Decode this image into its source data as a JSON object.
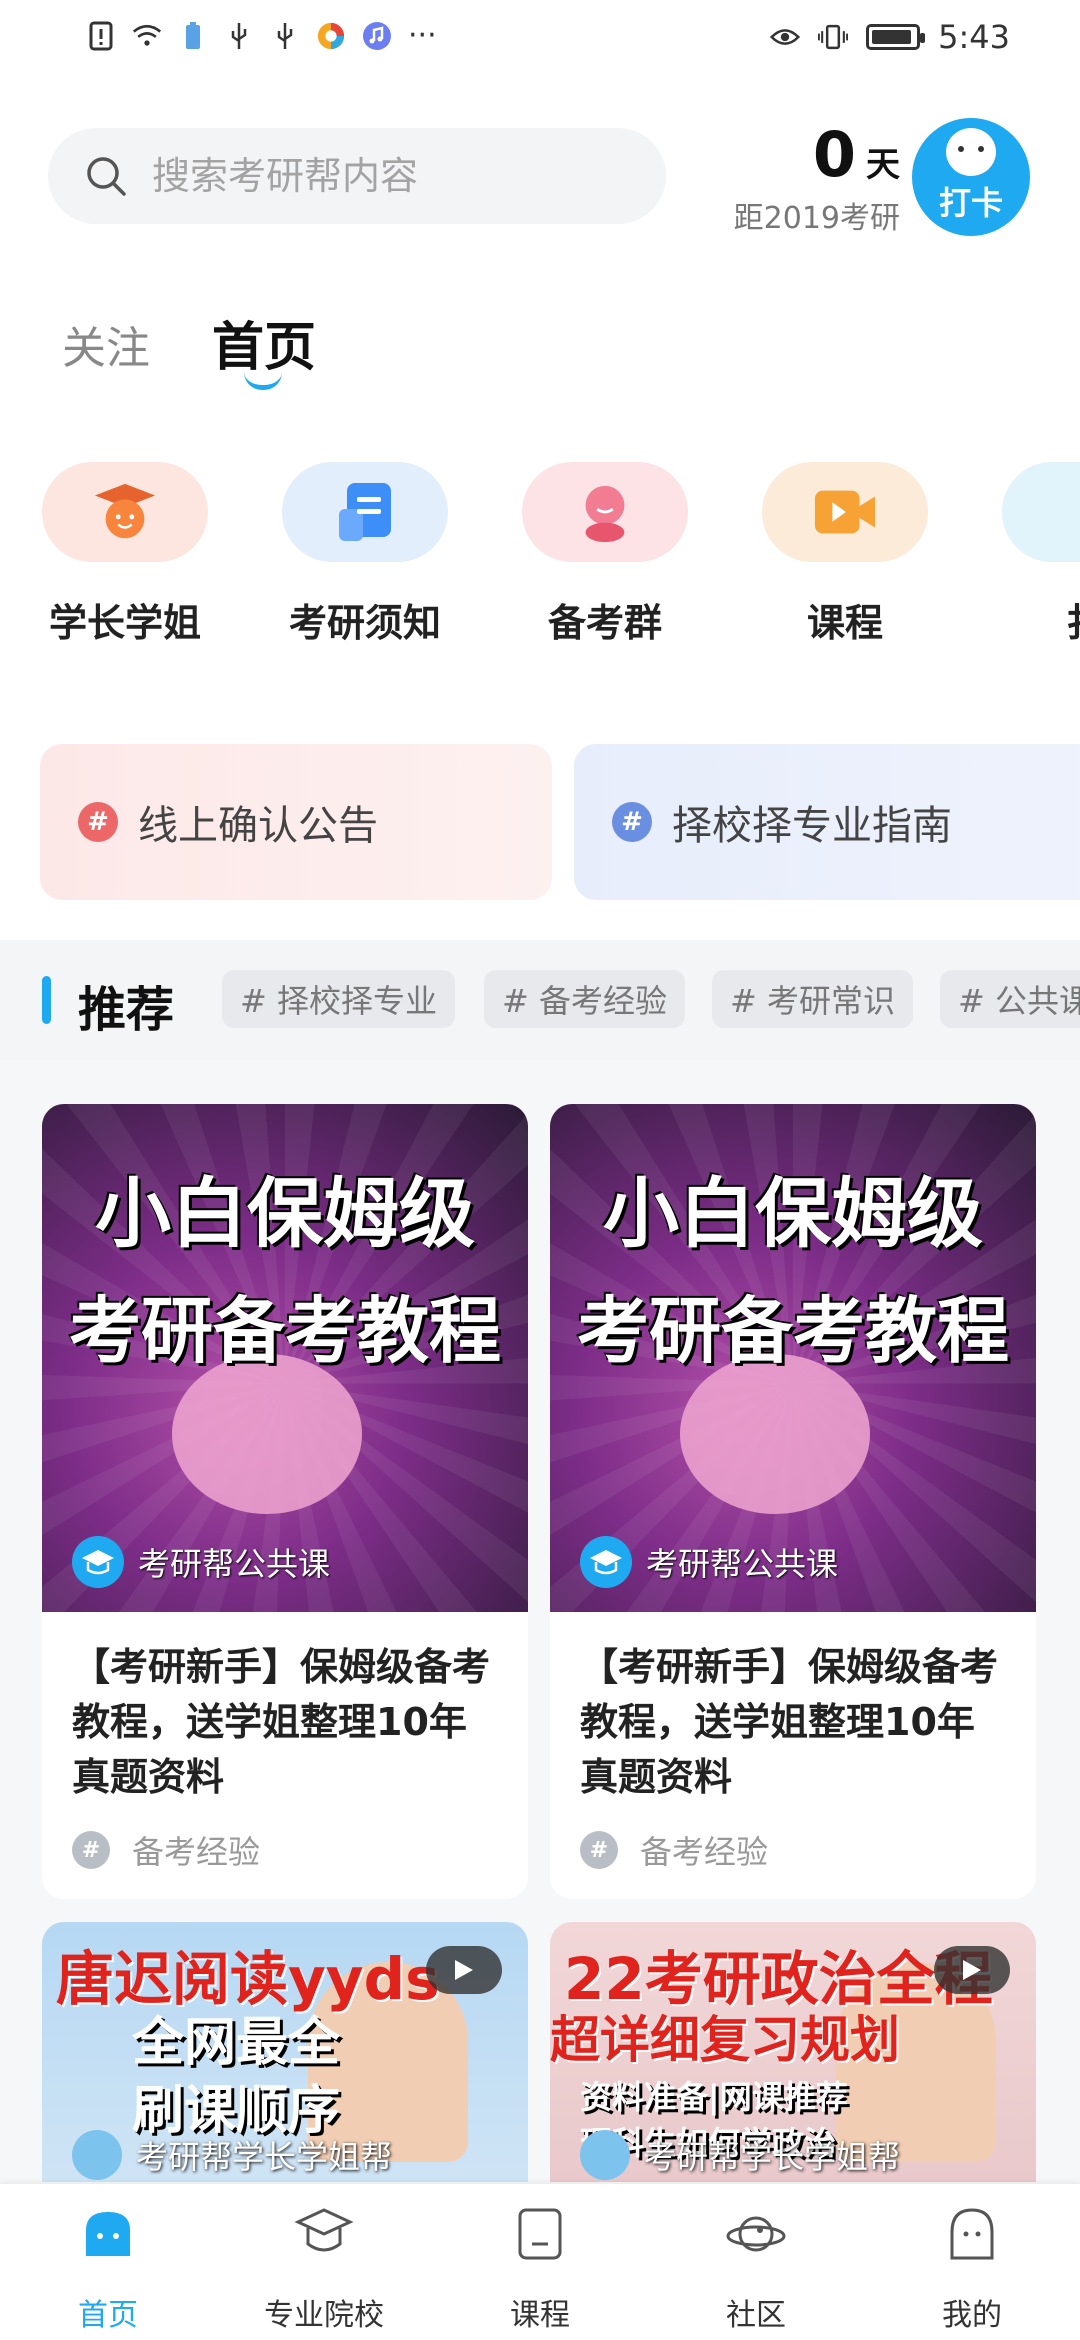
{
  "status_bar": {
    "time": "5:43",
    "more": "···"
  },
  "header": {
    "search_placeholder": "搜索考研帮内容",
    "countdown_number": "0",
    "countdown_unit": "天",
    "countdown_label": "距2019考研",
    "checkin_label": "打卡"
  },
  "top_tabs": {
    "follow": "关注",
    "home": "首页"
  },
  "entries": [
    {
      "label": "学长学姐"
    },
    {
      "label": "考研须知"
    },
    {
      "label": "备考群"
    },
    {
      "label": "课程"
    },
    {
      "label": "扌"
    }
  ],
  "notices": [
    {
      "label": "线上确认公告"
    },
    {
      "label": "择校择专业指南"
    }
  ],
  "recommend": {
    "title": "推荐",
    "tags": [
      "# 择校择专业",
      "# 备考经验",
      "# 考研常识",
      "# 公共课"
    ]
  },
  "cards": [
    {
      "thumb_line1": "小白保姆级",
      "thumb_line2": "考研备考教程",
      "source": "考研帮公共课",
      "title": "【考研新手】保姆级备考教程，送学姐整理10年真题资料",
      "tag": "备考经验"
    },
    {
      "thumb_line1": "小白保姆级",
      "thumb_line2": "考研备考教程",
      "source": "考研帮公共课",
      "title": "【考研新手】保姆级备考教程，送学姐整理10年真题资料",
      "tag": "备考经验"
    }
  ],
  "video_cards": [
    {
      "headline": "唐迟阅读yyds",
      "sub1": "全网最全",
      "sub2": "刷课顺序",
      "source": "考研帮学长学姐帮"
    },
    {
      "headline": "22考研政治全程",
      "sub1": "超详细复习规划",
      "sub2": "资料准备|网课推荐",
      "sub3": "理科生如何学政治",
      "source": "考研帮学长学姐帮"
    }
  ],
  "bottom_nav": [
    {
      "label": "首页",
      "icon": "home-icon"
    },
    {
      "label": "专业院校",
      "icon": "graduation-cap-icon"
    },
    {
      "label": "课程",
      "icon": "course-icon"
    },
    {
      "label": "社区",
      "icon": "community-planet-icon"
    },
    {
      "label": "我的",
      "icon": "profile-icon"
    }
  ],
  "colors": {
    "accent": "#1fa9f0",
    "notice_red": "#ee6b6b",
    "notice_blue": "#6b8fe0"
  }
}
